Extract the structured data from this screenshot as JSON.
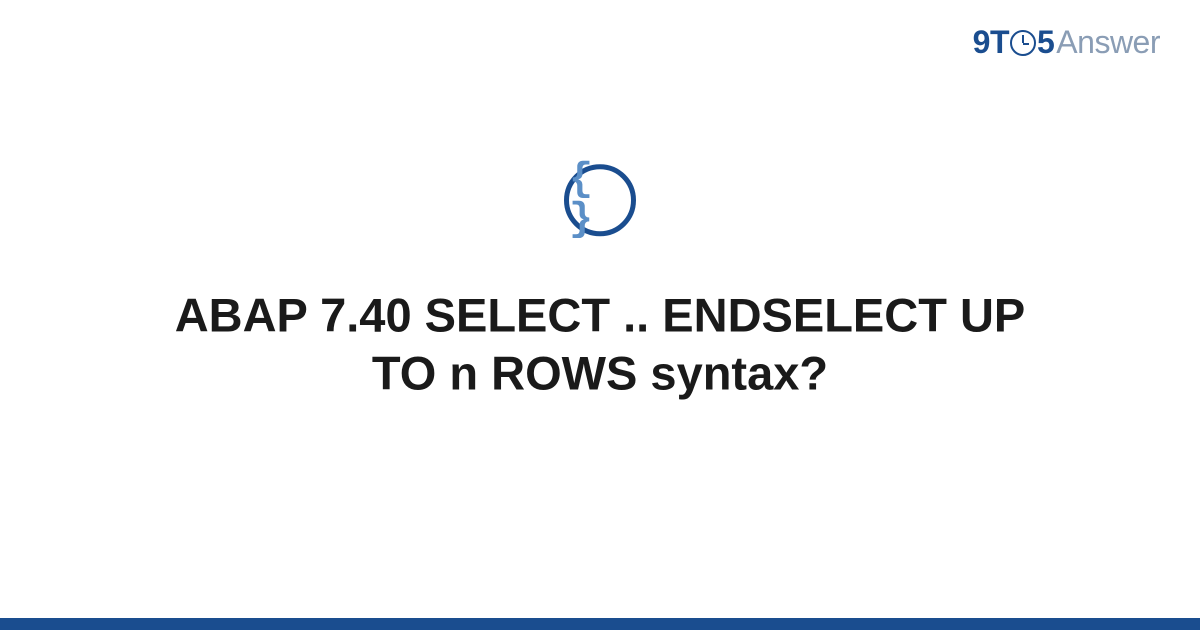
{
  "brand": {
    "nine": "9",
    "t": "T",
    "five": "5",
    "answer": "Answer"
  },
  "category_icon": {
    "name": "code-braces-icon",
    "symbol": "{ }"
  },
  "question": {
    "title": "ABAP 7.40 SELECT .. ENDSELECT UP TO n ROWS syntax?"
  },
  "colors": {
    "primary": "#1a4d8f",
    "secondary": "#8a9db5",
    "icon_inner": "#5b8fc7"
  }
}
